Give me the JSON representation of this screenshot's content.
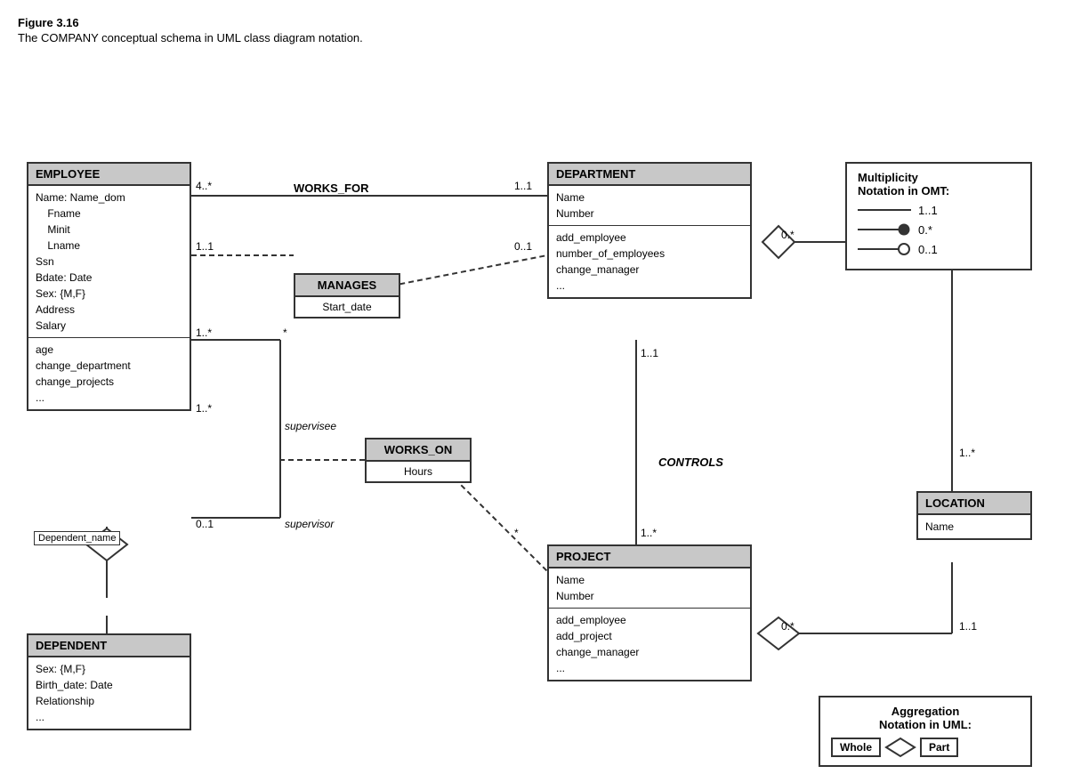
{
  "figure": {
    "title": "Figure 3.16",
    "caption": "The COMPANY conceptual schema in UML class diagram notation."
  },
  "classes": {
    "employee": {
      "header": "EMPLOYEE",
      "attributes": "Name: Name_dom\n    Fname\n    Minit\n    Lname\nSsn\nBdate: Date\nSex: {M,F}\nAddress\nSalary",
      "methods": "age\nchange_department\nchange_projects\n..."
    },
    "department": {
      "header": "DEPARTMENT",
      "attributes": "Name\nNumber",
      "methods": "add_employee\nnumber_of_employees\nchange_manager\n..."
    },
    "project": {
      "header": "PROJECT",
      "attributes": "Name\nNumber",
      "methods": "add_employee\nadd_project\nchange_manager\n..."
    },
    "dependent": {
      "header": "DEPENDENT",
      "attributes": "Sex: {M,F}\nBirth_date: Date\nRelationship\n..."
    },
    "location": {
      "header": "LOCATION",
      "attributes": "Name"
    }
  },
  "associations": {
    "manages": {
      "header": "MANAGES",
      "attr": "Start_date"
    },
    "works_on": {
      "header": "WORKS_ON",
      "attr": "Hours"
    }
  },
  "labels": {
    "works_for": "WORKS_FOR",
    "controls": "CONTROLS",
    "supervisee": "supervisee",
    "supervisor": "supervisor",
    "dependent_name": "Dependent_name",
    "mult_1_1_a": "4..*",
    "mult_1_1_b": "1..1",
    "mult_manages_left": "1..1",
    "mult_manages_right": "0..1",
    "mult_supervise_top": "1..*",
    "mult_supervise_star": "*",
    "mult_supervise_bottom": "0..1",
    "mult_workson_left": "1..*",
    "mult_workson_right": "*",
    "mult_controls_top": "1..1",
    "mult_controls_bottom": "1..*",
    "mult_dept_loc": "0.*",
    "mult_loc_dept": "1..*",
    "mult_loc_proj": "0.*",
    "mult_loc_bottom": "1..1"
  },
  "notation": {
    "title_line1": "Multiplicity",
    "title_line2": "Notation in OMT:",
    "row1_label": "1..1",
    "row2_label": "0.*",
    "row3_label": "0..1"
  },
  "aggregation": {
    "title_line1": "Aggregation",
    "title_line2": "Notation in UML:",
    "whole_label": "Whole",
    "part_label": "Part"
  }
}
